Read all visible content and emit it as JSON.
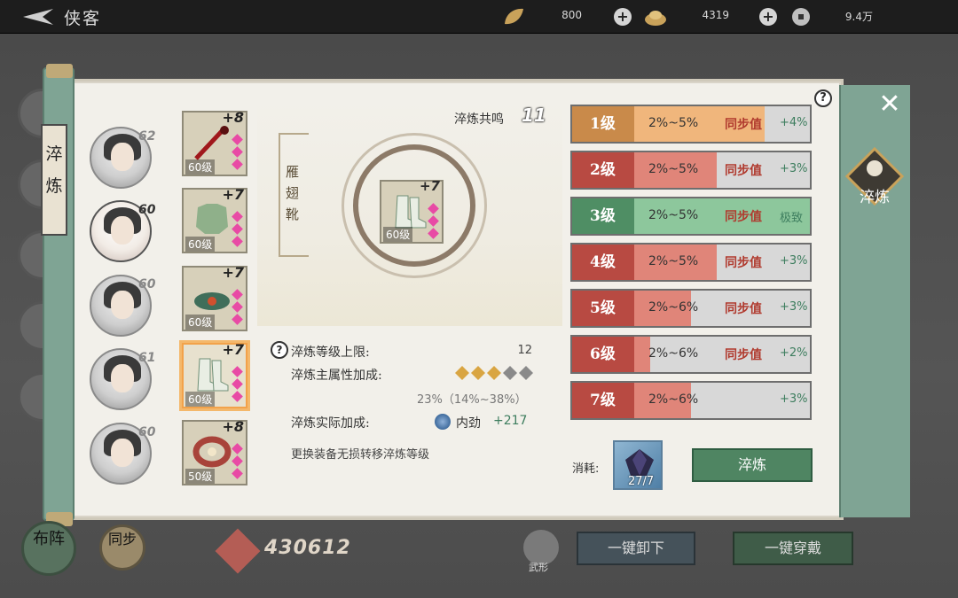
{
  "header": {
    "title": "侠客",
    "currencies": [
      {
        "icon": "leaf-currency-icon",
        "value": "800"
      },
      {
        "icon": "ingot-currency-icon",
        "value": "4319"
      },
      {
        "icon": "coin-currency-icon",
        "value": "9.4万"
      }
    ]
  },
  "scroll": {
    "label": "淬炼"
  },
  "right_tab": {
    "label": "淬炼"
  },
  "characters": [
    {
      "level": "62",
      "selected": false
    },
    {
      "level": "60",
      "selected": true
    },
    {
      "level": "60",
      "selected": false
    },
    {
      "level": "61",
      "selected": false
    },
    {
      "level": "60",
      "selected": false
    }
  ],
  "equipment": [
    {
      "plus": "+8",
      "level": "60级",
      "icon": "whip-weapon-icon"
    },
    {
      "plus": "+7",
      "level": "60级",
      "icon": "robe-armor-icon"
    },
    {
      "plus": "+7",
      "level": "60级",
      "icon": "belt-icon"
    },
    {
      "plus": "+7",
      "level": "60级",
      "icon": "boots-icon",
      "selected": true
    },
    {
      "plus": "+8",
      "level": "50级",
      "icon": "bracelet-icon"
    }
  ],
  "center": {
    "item_name": "雁翅靴",
    "item_plus": "+7",
    "item_level": "60级",
    "resonance_label": "淬炼共鸣",
    "resonance_value": "11"
  },
  "info": {
    "level_cap_label": "淬炼等级上限:",
    "level_cap_value": "12",
    "main_bonus_label": "淬炼主属性加成:",
    "stars_filled": 3,
    "stars_total": 5,
    "bonus_range": "23%（14%~38%）",
    "actual_label": "淬炼实际加成:",
    "actual_stat": "内劲",
    "actual_value": "+217",
    "transfer_note": "更换装备无损转移淬炼等级"
  },
  "levels": [
    {
      "label": "1级",
      "range": "2%~5%",
      "tag": "同步值",
      "result": "+4%",
      "style": "gold",
      "fill": 0.81
    },
    {
      "label": "2级",
      "range": "2%~5%",
      "tag": "同步值",
      "result": "+3%",
      "style": "red",
      "fill": 0.61
    },
    {
      "label": "3级",
      "range": "2%~5%",
      "tag": "同步值",
      "result": "极致",
      "style": "green",
      "fill": 1.0
    },
    {
      "label": "4级",
      "range": "2%~5%",
      "tag": "同步值",
      "result": "+3%",
      "style": "red",
      "fill": 0.61
    },
    {
      "label": "5级",
      "range": "2%~6%",
      "tag": "同步值",
      "result": "+3%",
      "style": "red",
      "fill": 0.5
    },
    {
      "label": "6级",
      "range": "2%~6%",
      "tag": "同步值",
      "result": "+2%",
      "style": "red",
      "fill": 0.33
    },
    {
      "label": "7级",
      "range": "2%~6%",
      "tag": "",
      "result": "+3%",
      "style": "red",
      "fill": 0.5
    }
  ],
  "cost": {
    "label": "消耗:",
    "count": "27/7",
    "icon": "crystal-material-icon"
  },
  "buttons": {
    "cuilian": "淬炼",
    "unequip_all": "一键卸下",
    "equip_all": "一键穿戴"
  },
  "bottom": {
    "left1_label": "布阵",
    "left2_label": "同步",
    "power": "430612",
    "wu_label": "武形"
  },
  "colors": {
    "gold": "#c98a4a",
    "red": "#b84a42",
    "green": "#4f8e64",
    "jade": "#7fa494"
  }
}
